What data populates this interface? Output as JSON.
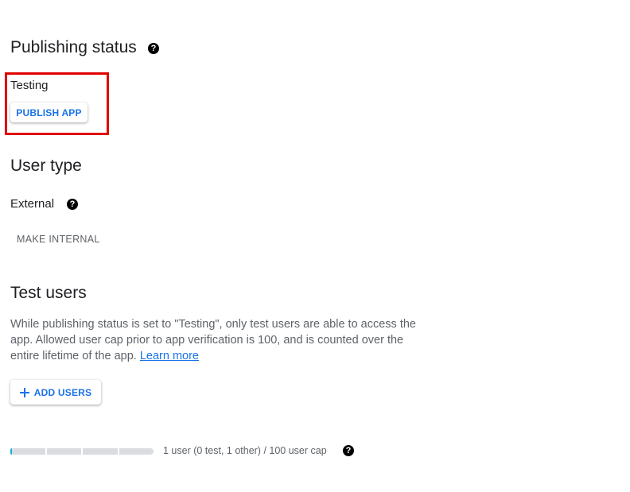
{
  "publishing": {
    "title": "Publishing status",
    "status": "Testing",
    "publish_button": "PUBLISH APP"
  },
  "user_type": {
    "title": "User type",
    "value": "External",
    "make_internal_button": "MAKE INTERNAL"
  },
  "test_users": {
    "title": "Test users",
    "description": "While publishing status is set to \"Testing\", only test users are able to access the app. Allowed user cap prior to app verification is 100, and is counted over the entire lifetime of the app.",
    "learn_more": "Learn more",
    "add_users_button": "ADD USERS",
    "add_icon": "plus-icon",
    "cap_text": "1 user (0 test, 1 other) / 100 user cap",
    "cap_used": 1,
    "cap_total": 100
  },
  "icons": {
    "help": "?"
  },
  "colors": {
    "accent": "#1a73e8",
    "highlight": "#e00000",
    "cap_fill": "#12b5cb"
  }
}
